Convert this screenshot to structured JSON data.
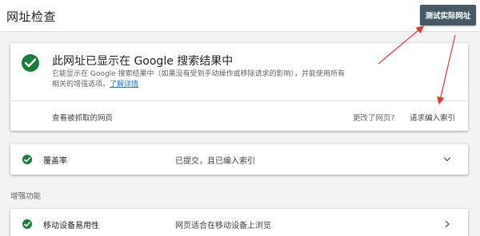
{
  "header": {
    "title": "网址检查",
    "test_live_button": "测试实际网址"
  },
  "status": {
    "title": "此网址已显示在 Google 搜索结果中",
    "description": "它能显示在 Google 搜索结果中（如果没有受到手动操作或移除请求的影响），并能使用所有相关的增强选项。",
    "learn_more": "了解详情",
    "view_crawled": "查看被抓取的网页",
    "changed_page": "更改了网页?",
    "request_indexing": "请求编入索引"
  },
  "coverage": {
    "label": "覆盖率",
    "value": "已提交，且已编入索引"
  },
  "enhancements": {
    "heading": "增强功能",
    "mobile": {
      "label": "移动设备易用性",
      "value": "网页适合在移动设备上浏览"
    }
  },
  "colors": {
    "success": "#188038",
    "button": "#455a64",
    "annotation_arrow": "#e53935",
    "link": "#1a73e8"
  },
  "icons": [
    "check-circle-icon",
    "chevron-down-icon",
    "chevron-right-icon"
  ]
}
